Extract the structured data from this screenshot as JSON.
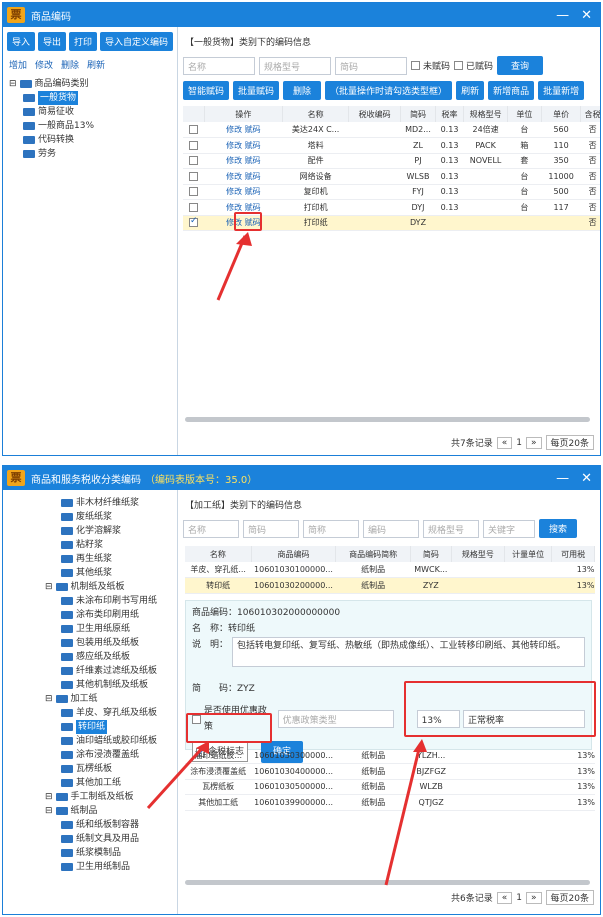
{
  "w1": {
    "title": "商品编码",
    "toolbar": [
      "导入",
      "导出",
      "打印",
      "导入自定义编码"
    ],
    "links": [
      "增加",
      "修改",
      "删除",
      "刷新"
    ],
    "tree_root": "商品编码类别",
    "tree": [
      "一般货物",
      "简易征收",
      "一般商品13%",
      "代码转换",
      "劳务"
    ],
    "header": "【一般货物】类别下的编码信息",
    "filters": {
      "name": "名称",
      "model": "规格型号",
      "abbr": "简码",
      "cb1": "未赋码",
      "cb2": "已赋码",
      "query": "查询"
    },
    "actions": [
      "智能赋码",
      "批量赋码",
      "删除",
      "（批量操作时请勾选类型框）",
      "刷新",
      "新增商品",
      "批量新增"
    ],
    "cols": [
      "",
      "操作",
      "名称",
      "税收编码",
      "简码",
      "税率",
      "规格型号",
      "单位",
      "单价",
      "含税"
    ],
    "rows": [
      [
        "修改",
        "赋码",
        "美达24X C...",
        "",
        "MD2...",
        "0.13",
        "24倍速",
        "台",
        "560",
        "否"
      ],
      [
        "修改",
        "赋码",
        "塔料",
        "",
        "ZL",
        "0.13",
        "PACK",
        "箱",
        "110",
        "否"
      ],
      [
        "修改",
        "赋码",
        "配件",
        "",
        "PJ",
        "0.13",
        "NOVELL",
        "套",
        "350",
        "否"
      ],
      [
        "修改",
        "赋码",
        "网络设备",
        "",
        "WLSB",
        "0.13",
        "",
        "台",
        "11000",
        "否"
      ],
      [
        "修改",
        "赋码",
        "复印机",
        "",
        "FYJ",
        "0.13",
        "",
        "台",
        "500",
        "否"
      ],
      [
        "修改",
        "赋码",
        "打印机",
        "",
        "DYJ",
        "0.13",
        "",
        "台",
        "117",
        "否"
      ],
      [
        "修改",
        "赋码",
        "打印纸",
        "",
        "DYZ",
        "",
        "",
        "",
        "",
        "否"
      ]
    ],
    "pager": {
      "total": "共7条记录",
      "page": "1",
      "size": "每页20条",
      "prev": "«",
      "next": "»"
    }
  },
  "w2": {
    "title": "商品和服务税收分类编码",
    "subtitle": "（编码表版本号：35.0）",
    "tree": [
      [
        "非木材纤维纸浆",
        3
      ],
      [
        "废纸纸浆",
        3
      ],
      [
        "化学溶解浆",
        3
      ],
      [
        "粘籽浆",
        3
      ],
      [
        "再生纸浆",
        3
      ],
      [
        "其他纸浆",
        3
      ],
      [
        "机制纸及纸板",
        2
      ],
      [
        "未涂布印刷书写用纸",
        3
      ],
      [
        "涂布类印刷用纸",
        3
      ],
      [
        "卫生用纸原纸",
        3
      ],
      [
        "包装用纸及纸板",
        3
      ],
      [
        "感应纸及纸板",
        3
      ],
      [
        "纤维素过滤纸及纸板",
        3
      ],
      [
        "其他机制纸及纸板",
        3
      ],
      [
        "加工纸",
        2
      ],
      [
        "羊皮、穿孔纸及纸板",
        3
      ],
      [
        "转印纸",
        3
      ],
      [
        "油印蜡纸或胶印纸板",
        3
      ],
      [
        "涂布浸渍覆盖纸",
        3
      ],
      [
        "瓦楞纸板",
        3
      ],
      [
        "其他加工纸",
        3
      ],
      [
        "手工制纸及纸板",
        2
      ],
      [
        "纸制品",
        2
      ],
      [
        "纸和纸板制容器",
        3
      ],
      [
        "纸制文具及用品",
        3
      ],
      [
        "纸浆模制品",
        3
      ],
      [
        "卫生用纸制品",
        3
      ]
    ],
    "header": "【加工纸】类别下的编码信息",
    "filters": [
      "名称",
      "简码",
      "简称",
      "编码",
      "规格型号",
      "关键字"
    ],
    "search": "搜索",
    "cols": [
      "名称",
      "商品编码",
      "商品编码简称",
      "简码",
      "规格型号",
      "计量单位",
      "可用税"
    ],
    "rows_top": [
      [
        "羊皮、穿孔纸...",
        "10601030100000...",
        "纸制品",
        "MWCK...",
        "",
        "",
        "13%"
      ],
      [
        "转印纸",
        "10601030200000...",
        "纸制品",
        "ZYZ",
        "",
        "",
        "13%"
      ]
    ],
    "detail": {
      "code_label": "商品编码：",
      "code": "106010302000000000",
      "name_label": "名　称：",
      "name": "转印纸",
      "desc_label": "说　明：",
      "desc": "包括转电复印纸、复写纸、热敏纸（即热成像纸）、工业转移印刷纸、其他转印纸。",
      "abbr_label": "简　　码：",
      "abbr": "ZYZ",
      "pref_label": "是否使用优惠政策",
      "pref_type": "优惠政策类型",
      "rate": "13%",
      "rate_type": "正常税率",
      "tax_flag": "含税标志",
      "ok": "确定"
    },
    "rows_bot": [
      [
        "油印蜡纸胶...",
        "10601030300000...",
        "纸制品",
        "YLZH...",
        "",
        "",
        "13%"
      ],
      [
        "涂布浸渍覆盖纸",
        "10601030400000...",
        "纸制品",
        "BJZFGZ",
        "",
        "",
        "13%"
      ],
      [
        "瓦楞纸板",
        "10601030500000...",
        "纸制品",
        "WLZB",
        "",
        "",
        "13%"
      ],
      [
        "其他加工纸",
        "10601039900000...",
        "纸制品",
        "QTJGZ",
        "",
        "",
        "13%"
      ]
    ],
    "pager": {
      "total": "共6条记录",
      "page": "1",
      "size": "每页20条",
      "prev": "«",
      "next": "»"
    }
  },
  "colors": {
    "accent": "#1b82db",
    "highlight": "#e53030"
  }
}
